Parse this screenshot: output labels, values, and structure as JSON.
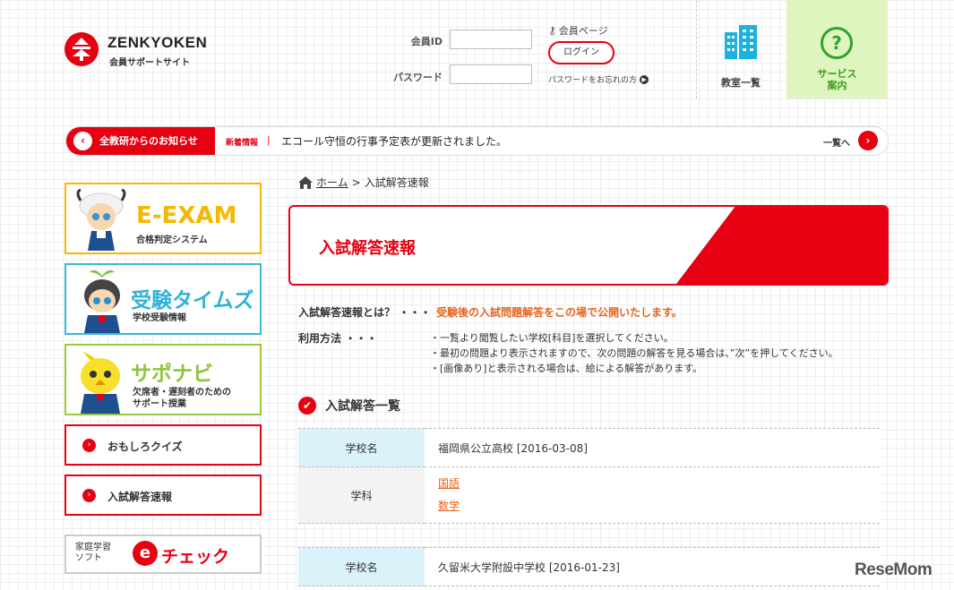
{
  "header": {
    "logo_name": "ZENKYOKEN",
    "logo_sub": "会員サポートサイト",
    "member_id_label": "会員ID",
    "password_label": "パスワード",
    "member_page_link": "会員ページ",
    "login_button": "ログイン",
    "forgot_password": "パスワードをお忘れの方",
    "nav_classroom": "教室一覧",
    "nav_service_line1": "サービス",
    "nav_service_line2": "案内",
    "member_id_value": "",
    "password_value": ""
  },
  "news": {
    "label": "全教研からのお知らせ",
    "tag": "新着情報",
    "separator": "|",
    "text": "エコール守恒の行事予定表が更新されました。",
    "more": "一覧へ"
  },
  "sidebar": {
    "eexam_title": "E-EXAM",
    "eexam_sub": "合格判定システム",
    "times_title": "受験タイムズ",
    "times_sub": "学校受験情報",
    "sapo_title": "サポナビ",
    "sapo_sub1": "欠席者・遅刻者のための",
    "sapo_sub2": "サポート授業",
    "quiz_link": "おもしろクイズ",
    "exam_link": "入試解答速報",
    "echeck_small1": "家庭学習",
    "echeck_small2": "ソフト",
    "echeck_title": "チェック"
  },
  "breadcrumb": {
    "home": "ホーム",
    "separator": ">",
    "current": "入試解答速報"
  },
  "main": {
    "title": "入試解答速報",
    "what_label": "入試解答速報とは？ ・・・",
    "what_value": "受験後の入試問題解答をこの場で公開いたします。",
    "usage_label": "利用方法 ・・・",
    "usage_lines": [
      "・一覧より閲覧したい学校[科目]を選択してください。",
      "・最初の問題より表示されますので、次の問題の解答を見る場合は、”次”を押してください。",
      "・[画像あり]と表示される場合は、絵による解答があります。"
    ],
    "list_title": "入試解答一覧",
    "entries": [
      {
        "school_label": "学校名",
        "school": "福岡県公立高校  [2016-03-08]",
        "subject_label": "学科",
        "subjects": [
          "国語",
          "数学"
        ]
      },
      {
        "school_label": "学校名",
        "school": "久留米大学附設中学校  [2016-01-23]"
      }
    ]
  },
  "watermark": "ReseMom",
  "colors": {
    "brand_red": "#e60012",
    "accent_orange": "#e8641b",
    "service_green": "#2fa32b",
    "classroom_blue": "#1ab3e0"
  }
}
